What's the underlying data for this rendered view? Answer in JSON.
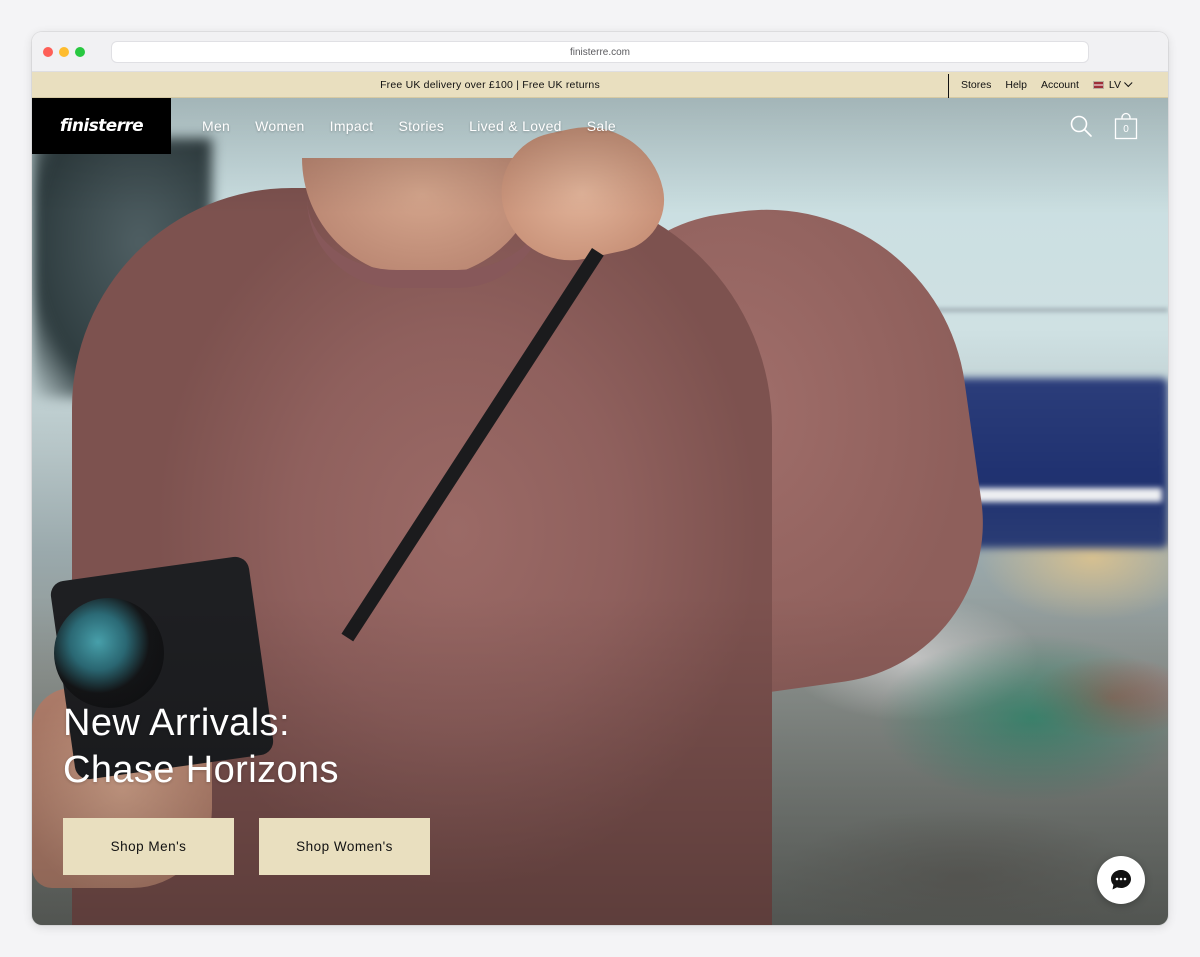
{
  "browser": {
    "url": "finisterre.com"
  },
  "announcement": {
    "text": "Free UK delivery over £100 | Free UK returns",
    "links": [
      "Stores",
      "Help",
      "Account"
    ],
    "language_code": "LV"
  },
  "header": {
    "logo_text": "finisterre",
    "nav": [
      "Men",
      "Women",
      "Impact",
      "Stories",
      "Lived & Loved",
      "Sale"
    ],
    "cart_count": "0",
    "icons": [
      "search-icon",
      "bag-icon"
    ]
  },
  "hero": {
    "title_line1": "New Arrivals:",
    "title_line2": "Chase Horizons",
    "buttons": [
      "Shop Men's",
      "Shop Women's"
    ]
  },
  "colors": {
    "accent_sand": "#e9dfbf",
    "logo_bg": "#000000",
    "text_dark": "#111111"
  }
}
